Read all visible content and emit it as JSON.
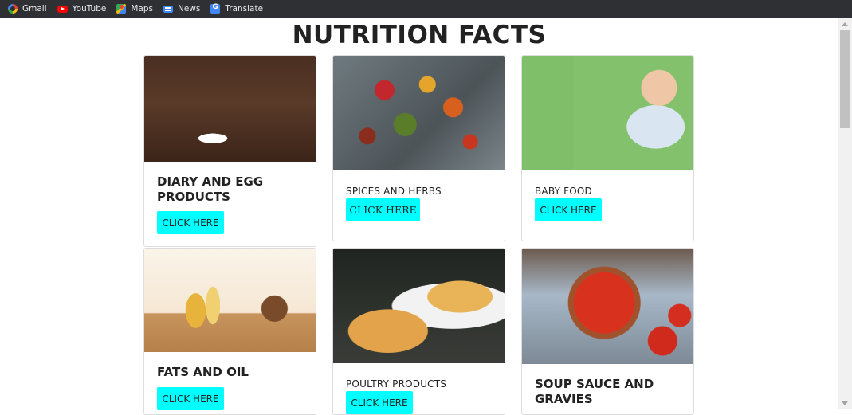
{
  "bookmarks": [
    {
      "label": "Gmail",
      "icon": "google-icon"
    },
    {
      "label": "YouTube",
      "icon": "youtube-icon"
    },
    {
      "label": "Maps",
      "icon": "maps-icon"
    },
    {
      "label": "News",
      "icon": "news-icon"
    },
    {
      "label": "Translate",
      "icon": "translate-icon"
    }
  ],
  "page": {
    "title": "NUTRITION FACTS"
  },
  "cards": [
    {
      "name": "DIARY AND EGG PRODUCTS",
      "button": "CLICK HERE"
    },
    {
      "name": "SPICES AND HERBS",
      "button": "CLICK HERE"
    },
    {
      "name": "BABY FOOD",
      "button": "CLICK HERE"
    },
    {
      "name": "FATS AND OIL",
      "button": "CLICK HERE"
    },
    {
      "name": "POULTRY PRODUCTS",
      "button": "CLICK HERE"
    },
    {
      "name": "SOUP SAUCE AND GRAVIES",
      "button": ""
    }
  ],
  "colors": {
    "button": "#00ffff",
    "bookmarks_bar": "#2f3033"
  }
}
